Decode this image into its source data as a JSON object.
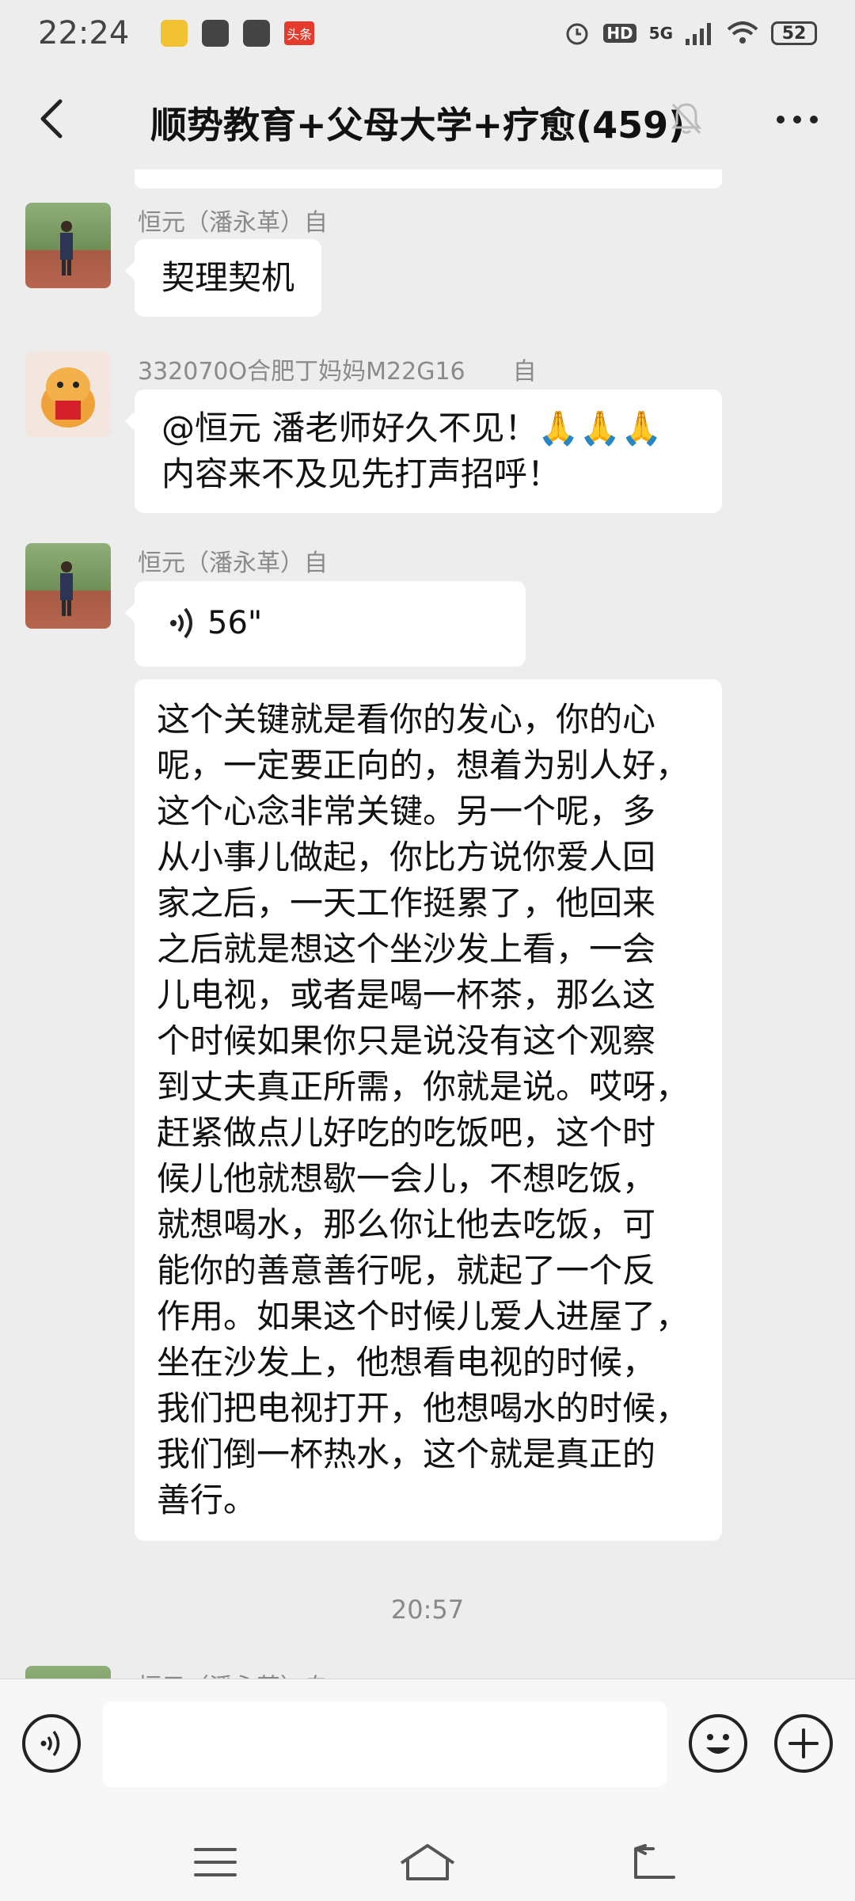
{
  "status_bar": {
    "time": "22:24",
    "network": "5G",
    "hd": "HD",
    "battery": "52",
    "app_icons": [
      "yellow-app-icon",
      "video-app-icon",
      "mail-app-icon",
      "toutiao-app-icon"
    ],
    "toutiao_label": "头条"
  },
  "header": {
    "title": "顺势教育+父母大学+疗愈(459)"
  },
  "messages": [
    {
      "sender": "恒元（潘永革）自",
      "text": "契理契机",
      "avatar": "landscape-avatar"
    },
    {
      "sender": "332070O合肥丁妈妈M22G16　　自",
      "lines": [
        "@恒元  潘老师好久不见！🙏🙏🙏",
        "内容来不及见先打声招呼！"
      ],
      "avatar": "tiger-avatar"
    },
    {
      "sender": "恒元（潘永革）自",
      "voice_duration": "56\"",
      "avatar": "landscape-avatar"
    },
    {
      "lines": [
        "这个关键就是看你的发心，你的心",
        "呢，一定要正向的，想着为别人好，",
        "这个心念非常关键。另一个呢，多",
        "从小事儿做起，你比方说你爱人回",
        "家之后，一天工作挺累了，他回来",
        "之后就是想这个坐沙发上看，一会",
        "儿电视，或者是喝一杯茶，那么这",
        "个时候如果你只是说没有这个观察",
        "到丈夫真正所需，你就是说。哎呀，",
        "赶紧做点儿好吃的吃饭吧，这个时",
        "候儿他就想歇一会儿，不想吃饭，",
        "就想喝水，那么你让他去吃饭，可",
        "能你的善意善行呢，就起了一个反",
        "作用。如果这个时候儿爱人进屋了，",
        "坐在沙发上，他想看电视的时候，",
        "我们把电视打开，他想喝水的时候，",
        "我们倒一杯热水，这个就是真正的",
        "善行。"
      ]
    }
  ],
  "time_divider": "20:57",
  "partial_sender": "恒元（潘永革）自",
  "input": {
    "placeholder": ""
  }
}
